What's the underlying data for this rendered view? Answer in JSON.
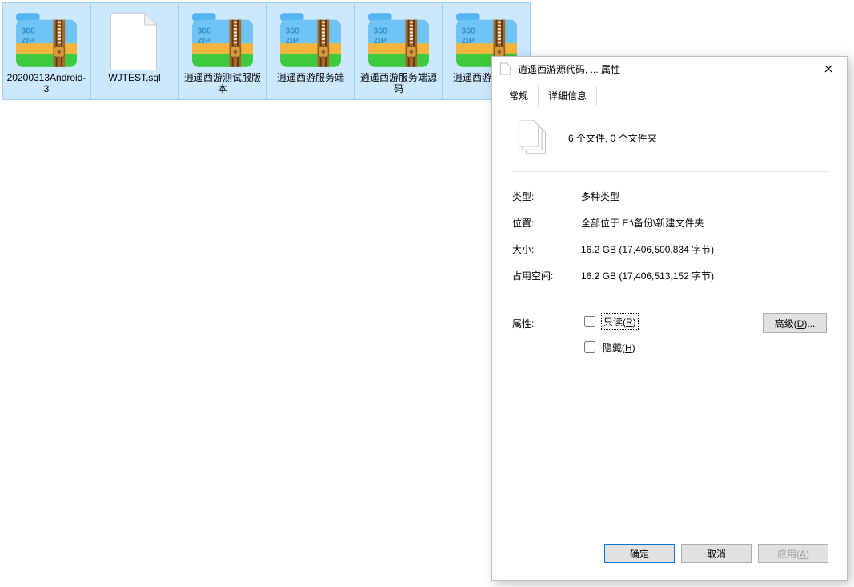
{
  "files": [
    {
      "name": "20200313Android-3",
      "icon": "zip",
      "selected": true
    },
    {
      "name": "WJTEST.sql",
      "icon": "blank",
      "selected": true
    },
    {
      "name": "逍遥西游测试服版本",
      "icon": "zip",
      "selected": true
    },
    {
      "name": "逍遥西游服务端",
      "icon": "zip",
      "selected": true
    },
    {
      "name": "逍遥西游服务端源码",
      "icon": "zip",
      "selected": true
    },
    {
      "name": "逍遥西游源代码",
      "icon": "zip",
      "selected": true,
      "truncated": true
    }
  ],
  "dialog": {
    "title": "逍遥西游源代码, ... 属性",
    "tabs": {
      "general": "常规",
      "details": "详细信息"
    },
    "summary": "6 个文件, 0 个文件夹",
    "labels": {
      "type": "类型:",
      "location": "位置:",
      "size": "大小:",
      "sizeOnDisk": "占用空间:",
      "attributes": "属性:"
    },
    "values": {
      "type": "多种类型",
      "location": "全部位于 E:\\备份\\新建文件夹",
      "size": "16.2 GB (17,406,500,834 字节)",
      "sizeOnDisk": "16.2 GB (17,406,513,152 字节)"
    },
    "attr": {
      "readonly_pre": "只读(",
      "readonly_key": "R",
      "readonly_post": ")",
      "hidden_pre": "隐藏(",
      "hidden_key": "H",
      "hidden_post": ")"
    },
    "advanced_pre": "高级(",
    "advanced_key": "D",
    "advanced_post": ")...",
    "buttons": {
      "ok": "确定",
      "cancel": "取消",
      "apply_pre": "应用(",
      "apply_key": "A",
      "apply_post": ")"
    }
  }
}
